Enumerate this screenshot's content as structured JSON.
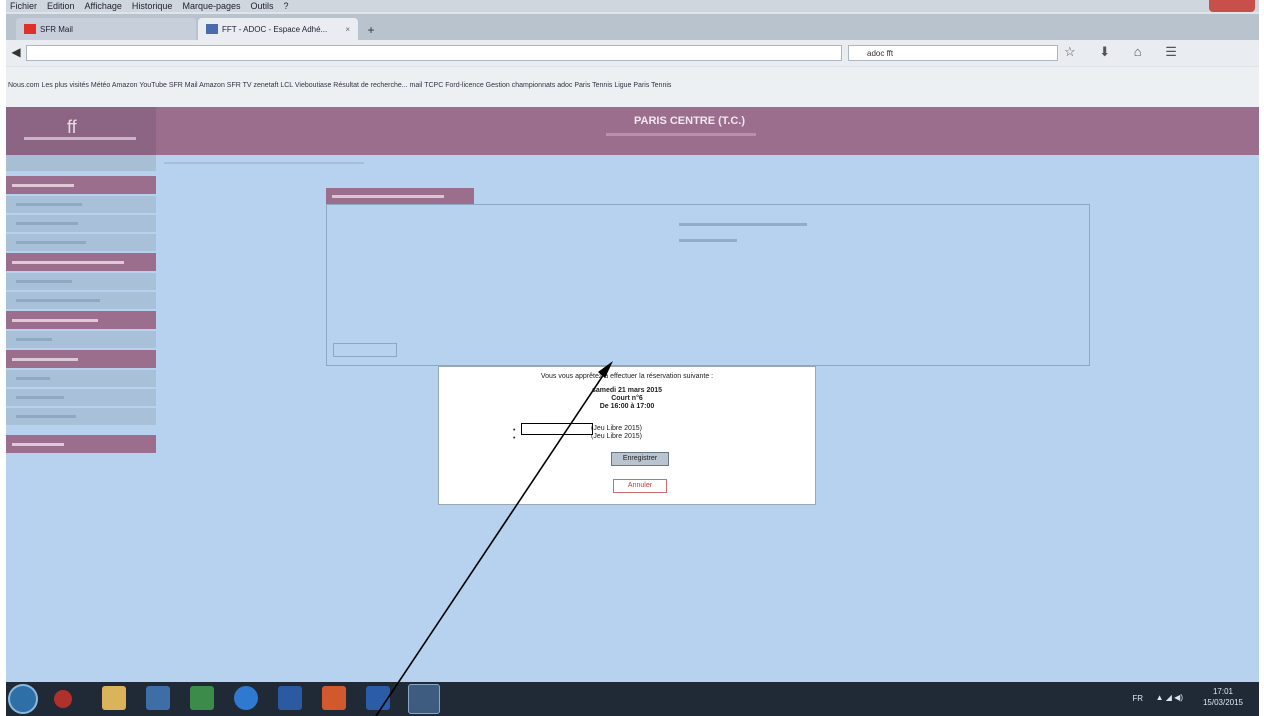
{
  "browser": {
    "menu": [
      "Fichier",
      "Edition",
      "Affichage",
      "Historique",
      "Marque-pages",
      "Outils",
      "?"
    ],
    "tabs": [
      {
        "title": "SFR Mail"
      },
      {
        "title": "FFT - ADOC - Espace Adhé..."
      }
    ],
    "search_value": "adoc fft",
    "bookmarks": "Nous.com  Les plus visités  Météo  Amazon  YouTube  SFR Mail  Amazon  SFR TV  zenetaft  LCL  Vieboutiase  Résultat de recherche...  mail TCPC  Ford-licence  Gestion championnats  adoc  Paris Tennis  Ligue Paris Tennis"
  },
  "page": {
    "club_title": "PARIS CENTRE (T.C.)"
  },
  "dialog": {
    "intro": "Vous vous apprêtez à effectuer la réservation suivante :",
    "date": "samedi 21 mars 2015",
    "court": "Court n°6",
    "time": "De 16:00 à 17:00",
    "players": [
      {
        "bullet": "•",
        "status": "(Jeu Libre 2015)"
      },
      {
        "bullet": "•",
        "status": "(Jeu Libre 2015)"
      }
    ],
    "save_label": "Enregistrer",
    "cancel_label": "Annuler"
  },
  "taskbar": {
    "lang": "FR",
    "time": "17:01",
    "date": "15/03/2015"
  }
}
